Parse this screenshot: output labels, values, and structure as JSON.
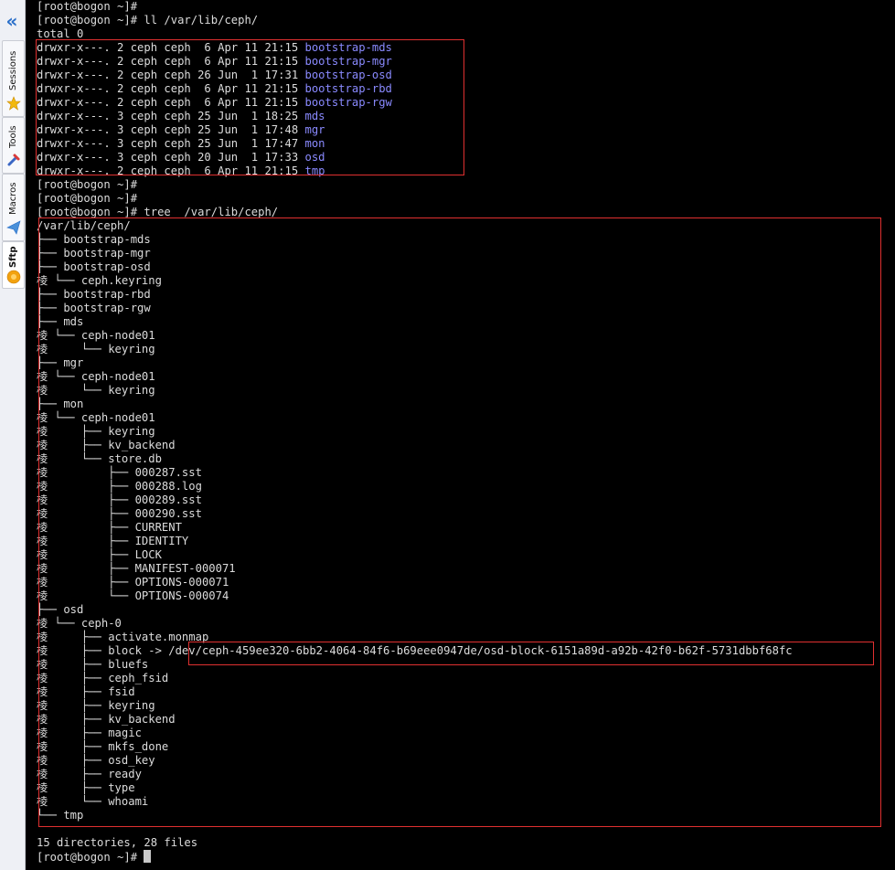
{
  "sidebar": {
    "tabs": [
      {
        "label": "Sessions",
        "icon": "star-icon"
      },
      {
        "label": "Tools",
        "icon": "tools-icon"
      },
      {
        "label": "Macros",
        "icon": "macros-icon"
      },
      {
        "label": "Sftp",
        "icon": "sftp-icon"
      }
    ]
  },
  "terminal": {
    "prompt": "[root@bogon ~]#",
    "lines": [
      "[root@bogon ~]#",
      "[root@bogon ~]# ll /var/lib/ceph/",
      "total 0",
      "drwxr-x---. 2 ceph ceph  6 Apr 11 21:15 ",
      "drwxr-x---. 2 ceph ceph  6 Apr 11 21:15 ",
      "drwxr-x---. 2 ceph ceph 26 Jun  1 17:31 ",
      "drwxr-x---. 2 ceph ceph  6 Apr 11 21:15 ",
      "drwxr-x---. 2 ceph ceph  6 Apr 11 21:15 ",
      "drwxr-x---. 3 ceph ceph 25 Jun  1 18:25 ",
      "drwxr-x---. 3 ceph ceph 25 Jun  1 17:48 ",
      "drwxr-x---. 3 ceph ceph 25 Jun  1 17:47 ",
      "drwxr-x---. 3 ceph ceph 20 Jun  1 17:33 ",
      "drwxr-x---. 2 ceph ceph  6 Apr 11 21:15 ",
      "[root@bogon ~]#",
      "[root@bogon ~]#",
      "[root@bogon ~]# tree  /var/lib/ceph/",
      "/var/lib/ceph/",
      "├── bootstrap-mds",
      "├── bootstrap-mgr",
      "├── bootstrap-osd",
      "棱 └── ceph.keyring",
      "├── bootstrap-rbd",
      "├── bootstrap-rgw",
      "├── mds",
      "棱 └── ceph-node01",
      "棱     └── keyring",
      "├── mgr",
      "棱 └── ceph-node01",
      "棱     └── keyring",
      "├── mon",
      "棱 └── ceph-node01",
      "棱     ├── keyring",
      "棱     ├── kv_backend",
      "棱     └── store.db",
      "棱         ├── 000287.sst",
      "棱         ├── 000288.log",
      "棱         ├── 000289.sst",
      "棱         ├── 000290.sst",
      "棱         ├── CURRENT",
      "棱         ├── IDENTITY",
      "棱         ├── LOCK",
      "棱         ├── MANIFEST-000071",
      "棱         ├── OPTIONS-000071",
      "棱         └── OPTIONS-000074",
      "├── osd",
      "棱 └── ceph-0",
      "棱     ├── activate.monmap",
      "棱     ├── block -> /dev/ceph-459ee320-6bb2-4064-84f6-b69eee0947de/osd-block-6151a89d-a92b-42f0-b62f-5731dbbf68fc",
      "棱     ├── bluefs",
      "棱     ├── ceph_fsid",
      "棱     ├── fsid",
      "棱     ├── keyring",
      "棱     ├── kv_backend",
      "棱     ├── magic",
      "棱     ├── mkfs_done",
      "棱     ├── osd_key",
      "棱     ├── ready",
      "棱     ├── type",
      "棱     └── whoami",
      "└── tmp",
      "",
      "15 directories, 28 files",
      "[root@bogon ~]# "
    ],
    "ll_names": [
      "bootstrap-mds",
      "bootstrap-mgr",
      "bootstrap-osd",
      "bootstrap-rbd",
      "bootstrap-rgw",
      "mds",
      "mgr",
      "mon",
      "osd",
      "tmp"
    ]
  },
  "colors": {
    "background": "#000000",
    "text": "#dcdcdc",
    "directory": "#8a8aff",
    "highlight_box": "#e03030"
  }
}
